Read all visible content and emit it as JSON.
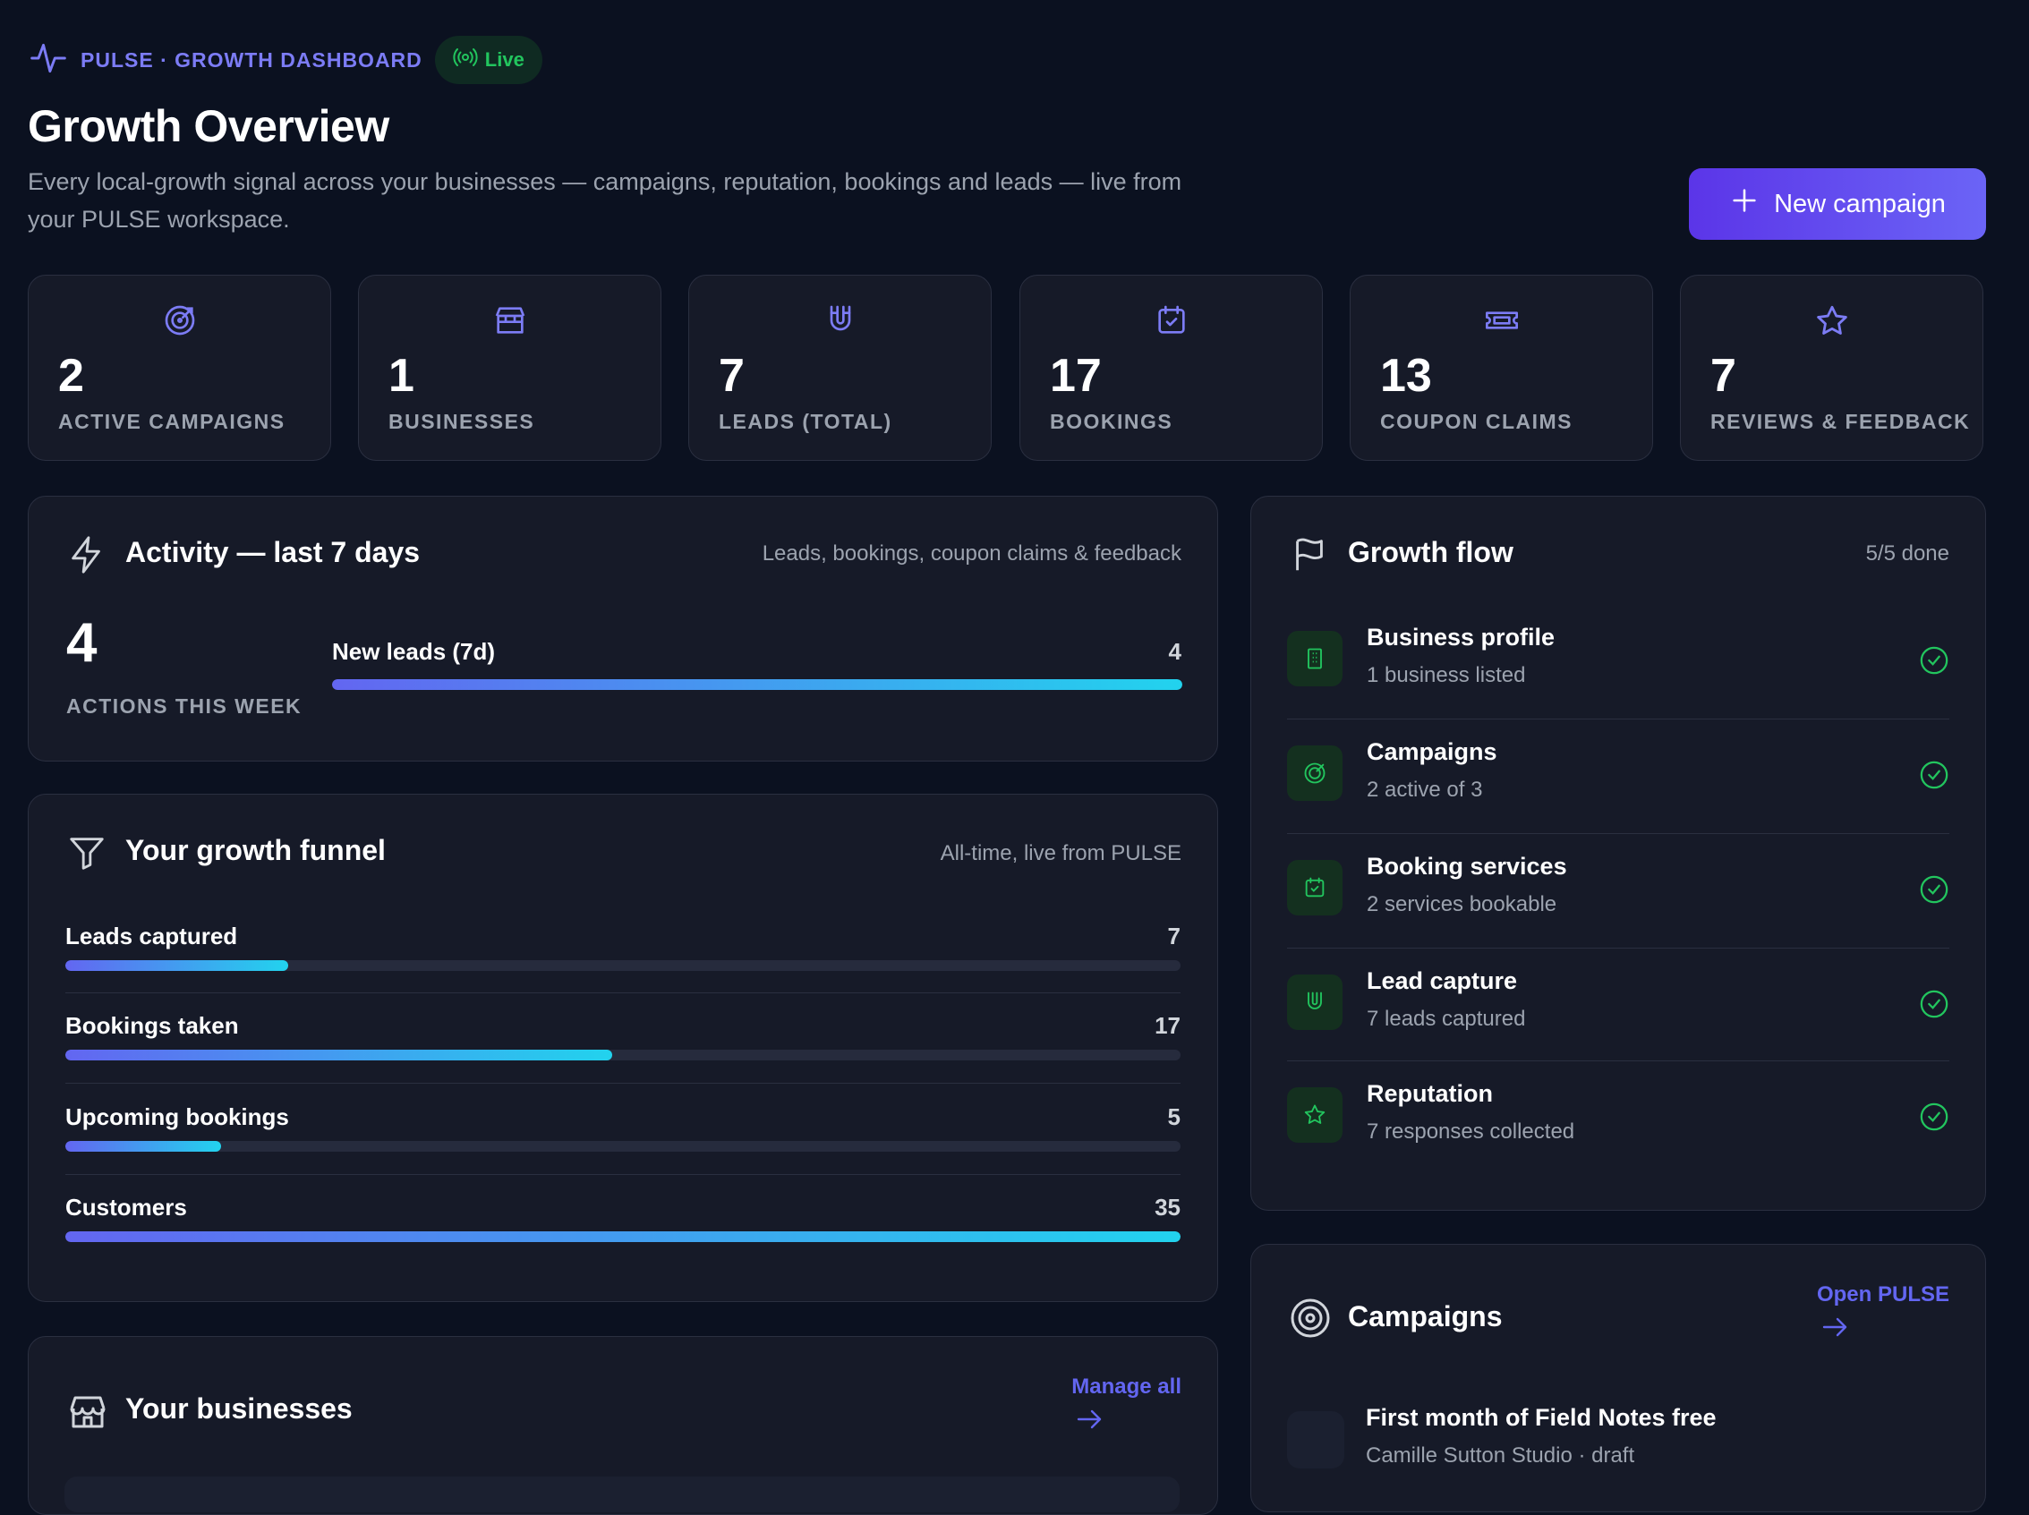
{
  "header": {
    "brand": "PULSE · GROWTH DASHBOARD",
    "live_label": "Live",
    "title": "Growth Overview",
    "subtitle": "Every local-growth signal across your businesses — campaigns, reputation, bookings and leads — live from your PULSE workspace.",
    "new_campaign_label": "New campaign"
  },
  "stats": [
    {
      "value": "2",
      "label": "ACTIVE CAMPAIGNS",
      "icon": "target-icon"
    },
    {
      "value": "1",
      "label": "BUSINESSES",
      "icon": "store-icon"
    },
    {
      "value": "7",
      "label": "LEADS (TOTAL)",
      "icon": "magnet-icon"
    },
    {
      "value": "17",
      "label": "BOOKINGS",
      "icon": "calendar-check-icon"
    },
    {
      "value": "13",
      "label": "COUPON CLAIMS",
      "icon": "ticket-icon"
    },
    {
      "value": "7",
      "label": "REVIEWS & FEEDBACK",
      "icon": "star-icon"
    }
  ],
  "activity": {
    "title": "Activity — last 7 days",
    "note": "Leads, bookings, coupon claims & feedback",
    "count": "4",
    "count_label": "ACTIONS THIS WEEK",
    "bar_label": "New leads (7d)",
    "bar_value": "4",
    "bar_fraction": 1.0
  },
  "funnel": {
    "title": "Your growth funnel",
    "note": "All-time, live from PULSE",
    "rows": [
      {
        "name": "Leads captured",
        "value": "7",
        "fraction": 0.2
      },
      {
        "name": "Bookings taken",
        "value": "17",
        "fraction": 0.49
      },
      {
        "name": "Upcoming bookings",
        "value": "5",
        "fraction": 0.14
      },
      {
        "name": "Customers",
        "value": "35",
        "fraction": 1.0
      }
    ]
  },
  "businesses": {
    "title": "Your businesses",
    "link": "Manage all"
  },
  "flow": {
    "title": "Growth flow",
    "status": "5/5 done",
    "steps": [
      {
        "name": "Business profile",
        "sub": "1 business listed",
        "icon": "building-icon"
      },
      {
        "name": "Campaigns",
        "sub": "2 active of 3",
        "icon": "target-icon"
      },
      {
        "name": "Booking services",
        "sub": "2 services bookable",
        "icon": "calendar-check-icon"
      },
      {
        "name": "Lead capture",
        "sub": "7 leads captured",
        "icon": "magnet-icon"
      },
      {
        "name": "Reputation",
        "sub": "7 responses collected",
        "icon": "star-icon"
      }
    ]
  },
  "campaigns": {
    "title": "Campaigns",
    "link": "Open PULSE",
    "items": [
      {
        "name": "First month of Field Notes free",
        "meta": "Camille Sutton Studio · draft"
      }
    ]
  },
  "colors": {
    "background": "#0b1120",
    "card": "#161a28",
    "accent": "#6366f1",
    "success": "#22c55e",
    "gradient_end": "#22d3ee"
  }
}
